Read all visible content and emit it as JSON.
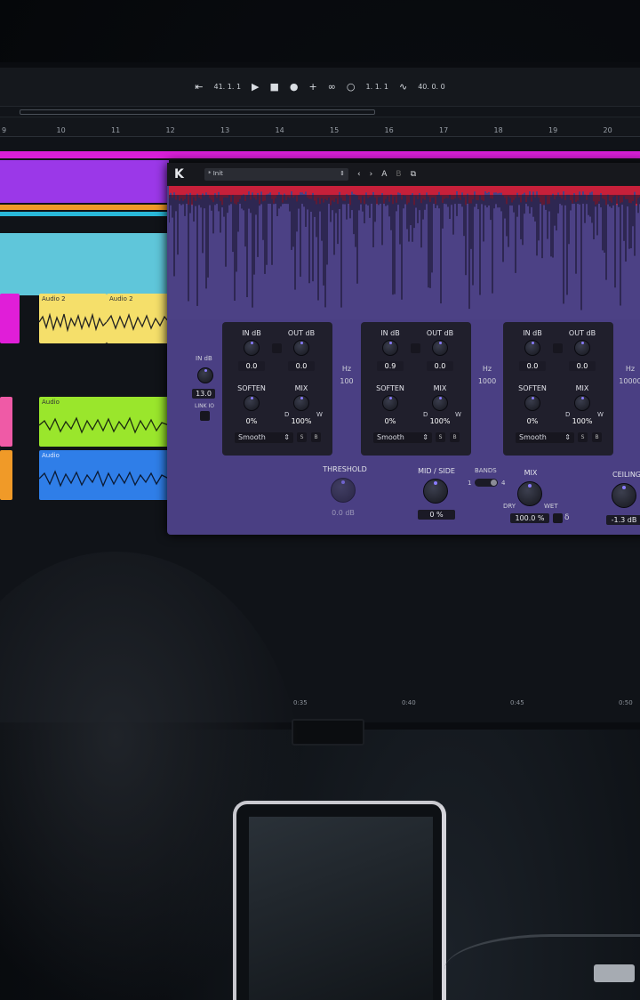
{
  "toolbar": {
    "position": "41. 1. 1",
    "loop_position": "1. 1. 1",
    "tempo": "40. 0. 0"
  },
  "ruler": {
    "ticks": [
      "9",
      "10",
      "11",
      "12",
      "13",
      "14",
      "15",
      "16",
      "17",
      "18",
      "19",
      "20"
    ]
  },
  "clips": {
    "audio2_a": "Audio 2",
    "audio2_b": "Audio 2",
    "audio_green": "Audio",
    "audio_blue": "Audio"
  },
  "plugin": {
    "logo": "K",
    "preset": "* Init",
    "ab_a": "A",
    "ab_b": "B",
    "in_db_label": "IN dB",
    "in_db_value": "13.0",
    "link_io": "LINK IO",
    "bands": [
      {
        "in_label": "IN dB",
        "out_label": "OUT dB",
        "in_value": "0.0",
        "out_value": "0.0",
        "soften_label": "SOFTEN",
        "mix_label": "MIX",
        "soften_value": "0%",
        "mix_value": "100%",
        "dw_d": "D",
        "dw_w": "W",
        "mode": "Smooth",
        "s": "S",
        "b": "B"
      },
      {
        "in_label": "IN dB",
        "out_label": "OUT dB",
        "in_value": "0.9",
        "out_value": "0.0",
        "soften_label": "SOFTEN",
        "mix_label": "MIX",
        "soften_value": "0%",
        "mix_value": "100%",
        "dw_d": "D",
        "dw_w": "W",
        "mode": "Smooth",
        "s": "S",
        "b": "B"
      },
      {
        "in_label": "IN dB",
        "out_label": "OUT dB",
        "in_value": "0.0",
        "out_value": "0.0",
        "soften_label": "SOFTEN",
        "mix_label": "MIX",
        "soften_value": "0%",
        "mix_value": "100%",
        "dw_d": "D",
        "dw_w": "W",
        "mode": "Smooth",
        "s": "S",
        "b": "B"
      }
    ],
    "crossovers": [
      {
        "unit": "Hz",
        "value": "100"
      },
      {
        "unit": "Hz",
        "value": "1000"
      },
      {
        "unit": "Hz",
        "value": "10000"
      }
    ],
    "threshold_label": "THRESHOLD",
    "threshold_value": "0.0 dB",
    "midside_label": "MID / SIDE",
    "midside_value": "0 %",
    "bands_label": "BANDS",
    "bands_min": "1",
    "bands_max": "4",
    "mix_label": "MIX",
    "mix_dry": "DRY",
    "mix_wet": "WET",
    "mix_value": "100.0 %",
    "delta": "δ",
    "ceiling_label": "CEILING",
    "ceiling_value": "-1.3 dB"
  },
  "timeline": {
    "marks": [
      "0:35",
      "0:40",
      "0:45",
      "0:50"
    ]
  },
  "colors": {
    "plugin_bg": "#4a3f83",
    "accent": "#8a7cff",
    "magenta": "#d81fd8",
    "purple_clip": "#9b38e8",
    "cyan": "#29b8d9",
    "yellow": "#f5df6a",
    "green": "#9ae62c",
    "blue": "#2f7ee8",
    "pink": "#ef5aa6",
    "orange": "#f09a28",
    "waveform_red": "#c7203a"
  }
}
